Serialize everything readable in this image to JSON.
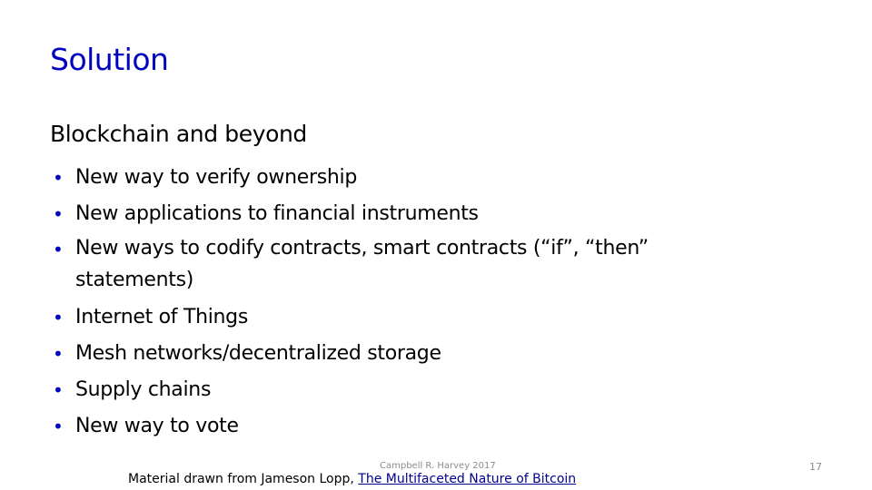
{
  "slide": {
    "title": "Solution",
    "subtitle": "Blockchain and beyond",
    "bullets": [
      "New way to verify ownership",
      "New applications to financial instruments",
      "New ways to codify contracts, smart contracts (“if”, “then” statements)",
      "Internet of Things",
      "Mesh networks/decentralized storage",
      "Supply chains",
      "New way to vote"
    ],
    "bullet_glyph": "•",
    "footer": {
      "credit": "Campbell R. Harvey 2017",
      "source_prefix": "Material drawn from Jameson Lopp, ",
      "source_link": "The Multifaceted Nature of Bitcoin",
      "page_number": "17"
    }
  },
  "colors": {
    "title": "#0000c0",
    "bullet": "#0000c0",
    "link": "#000090",
    "footer_text": "#8c8c8c"
  }
}
